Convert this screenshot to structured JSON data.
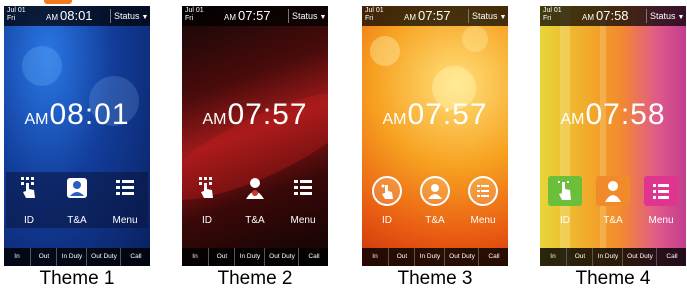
{
  "themes": [
    {
      "caption": "Theme 1",
      "date_line1": "Jul 01",
      "date_line2": "Fri",
      "top_ampm": "AM",
      "top_time": "08:01",
      "status_label": "Status",
      "big_ampm": "AM",
      "big_time": "08:01",
      "tiles": [
        {
          "label": "ID",
          "icon": "finger-touch-icon"
        },
        {
          "label": "T&A",
          "icon": "user-clock-icon"
        },
        {
          "label": "Menu",
          "icon": "menu-list-icon"
        }
      ],
      "bottom": [
        "In",
        "Out",
        "In Duty",
        "Out Duty",
        "Call"
      ]
    },
    {
      "caption": "Theme 2",
      "date_line1": "Jul 01",
      "date_line2": "Fri",
      "top_ampm": "AM",
      "top_time": "07:57",
      "status_label": "Status",
      "big_ampm": "AM",
      "big_time": "07:57",
      "tiles": [
        {
          "label": "ID",
          "icon": "finger-touch-icon"
        },
        {
          "label": "T&A",
          "icon": "user-clock-icon"
        },
        {
          "label": "Menu",
          "icon": "menu-list-icon"
        }
      ],
      "bottom": [
        "In",
        "Out",
        "In Duty",
        "Out Duty",
        "Call"
      ]
    },
    {
      "caption": "Theme 3",
      "date_line1": "Jul 01",
      "date_line2": "Fri",
      "top_ampm": "AM",
      "top_time": "07:57",
      "status_label": "Status",
      "big_ampm": "AM",
      "big_time": "07:57",
      "tiles": [
        {
          "label": "ID",
          "icon": "finger-touch-icon"
        },
        {
          "label": "T&A",
          "icon": "user-clock-icon"
        },
        {
          "label": "Menu",
          "icon": "menu-list-icon"
        }
      ],
      "bottom": [
        "In",
        "Out",
        "In Duty",
        "Out Duty",
        "Call"
      ]
    },
    {
      "caption": "Theme 4",
      "date_line1": "Jul 01",
      "date_line2": "Fri",
      "top_ampm": "AM",
      "top_time": "07:58",
      "status_label": "Status",
      "big_ampm": "AM",
      "big_time": "07:58",
      "tiles": [
        {
          "label": "ID",
          "icon": "finger-touch-icon"
        },
        {
          "label": "T&A",
          "icon": "user-clock-icon"
        },
        {
          "label": "Menu",
          "icon": "menu-list-icon"
        }
      ],
      "bottom": [
        "In",
        "Out",
        "In Duty",
        "Out Duty",
        "Call"
      ]
    }
  ],
  "colors": {
    "accent": "#f27a1e",
    "theme4_tile_id": "#6bbf3a",
    "theme4_tile_ta": "#f08a2a",
    "theme4_tile_menu": "#e0358f"
  }
}
